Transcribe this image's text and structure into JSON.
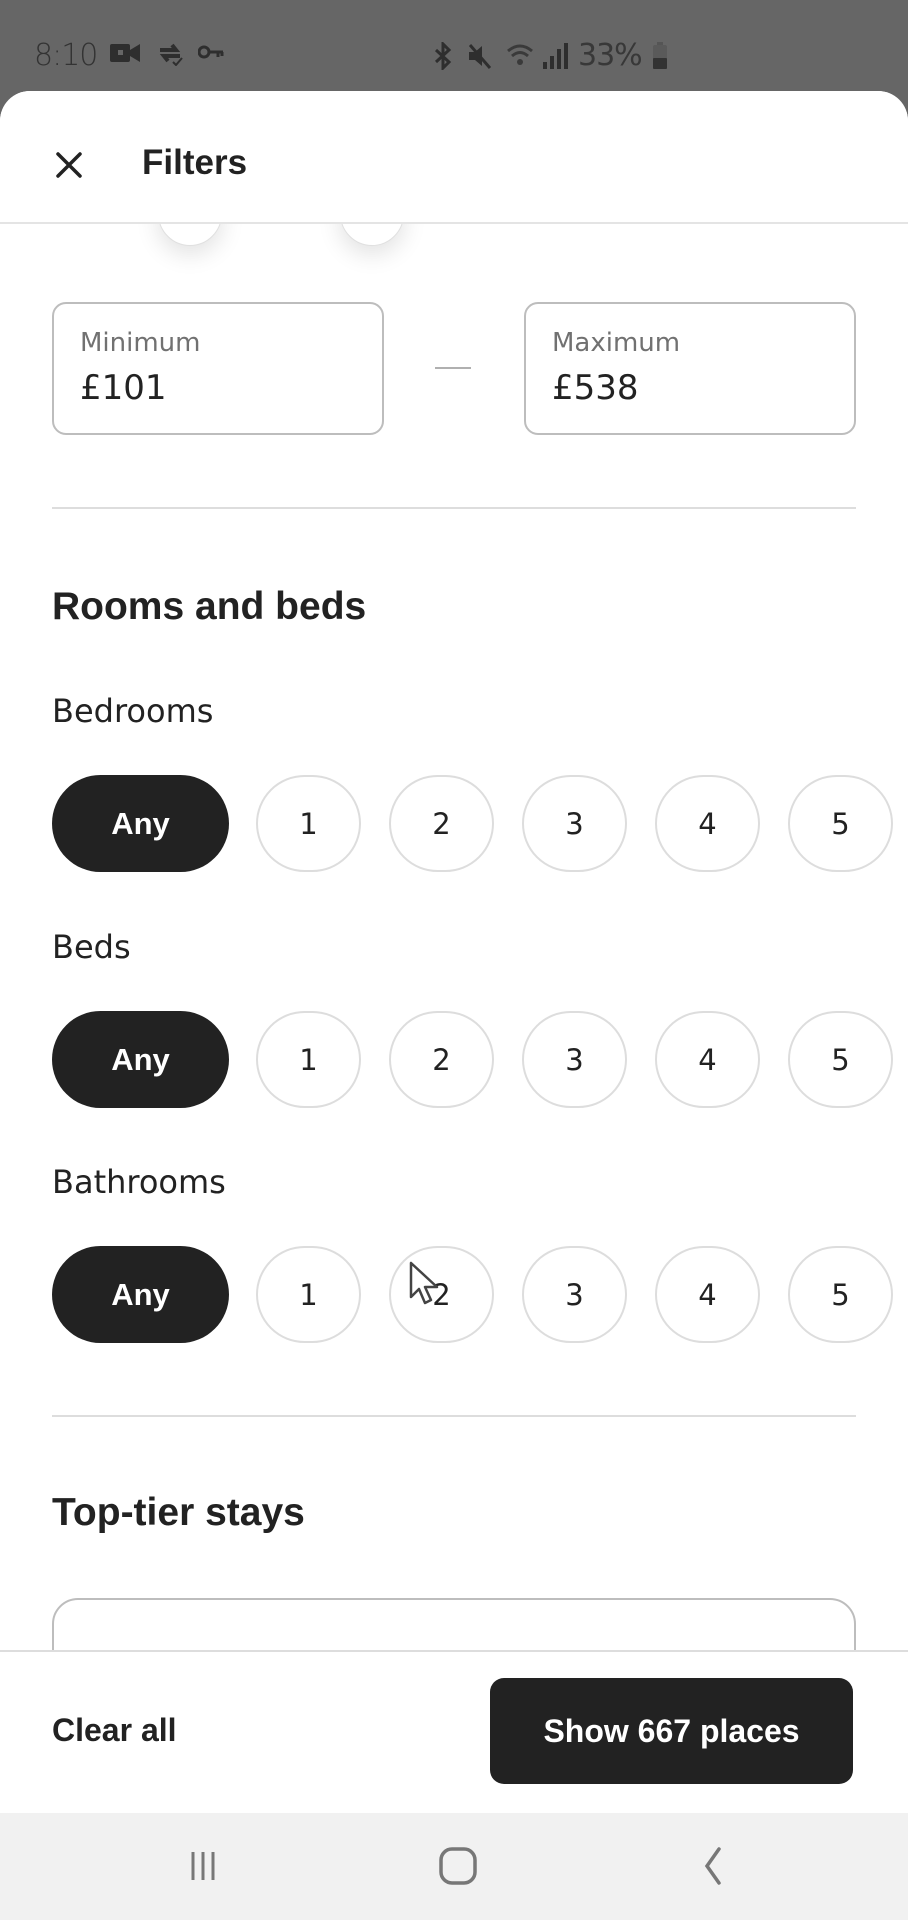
{
  "status_bar": {
    "time": "8:10",
    "left_icons": [
      "video-camera-icon",
      "sync-check-icon",
      "vpn-key-icon"
    ],
    "right_icons": [
      "bluetooth-icon",
      "mute-icon",
      "wifi-icon",
      "signal-icon"
    ],
    "battery_percent": "33%"
  },
  "header": {
    "title": "Filters",
    "close_icon": "close-icon"
  },
  "price_range": {
    "minimum": {
      "label": "Minimum",
      "value": "£101"
    },
    "maximum": {
      "label": "Maximum",
      "value": "£538"
    }
  },
  "rooms_and_beds": {
    "title": "Rooms and beds",
    "groups": [
      {
        "label": "Bedrooms",
        "options": [
          "Any",
          "1",
          "2",
          "3",
          "4",
          "5"
        ],
        "selected": "Any"
      },
      {
        "label": "Beds",
        "options": [
          "Any",
          "1",
          "2",
          "3",
          "4",
          "5"
        ],
        "selected": "Any"
      },
      {
        "label": "Bathrooms",
        "options": [
          "Any",
          "1",
          "2",
          "3",
          "4",
          "5"
        ],
        "selected": "Any"
      }
    ]
  },
  "top_tier": {
    "title": "Top-tier stays"
  },
  "footer": {
    "clear_label": "Clear all",
    "show_label": "Show 667 places"
  },
  "nav_bar": {
    "icons": [
      "recent-apps-icon",
      "home-icon",
      "back-icon"
    ]
  },
  "colors": {
    "primary_dark": "#222222",
    "border": "#dddddd",
    "status_bar_bg": "#666666",
    "nav_bar_bg": "#f1f1f1"
  }
}
